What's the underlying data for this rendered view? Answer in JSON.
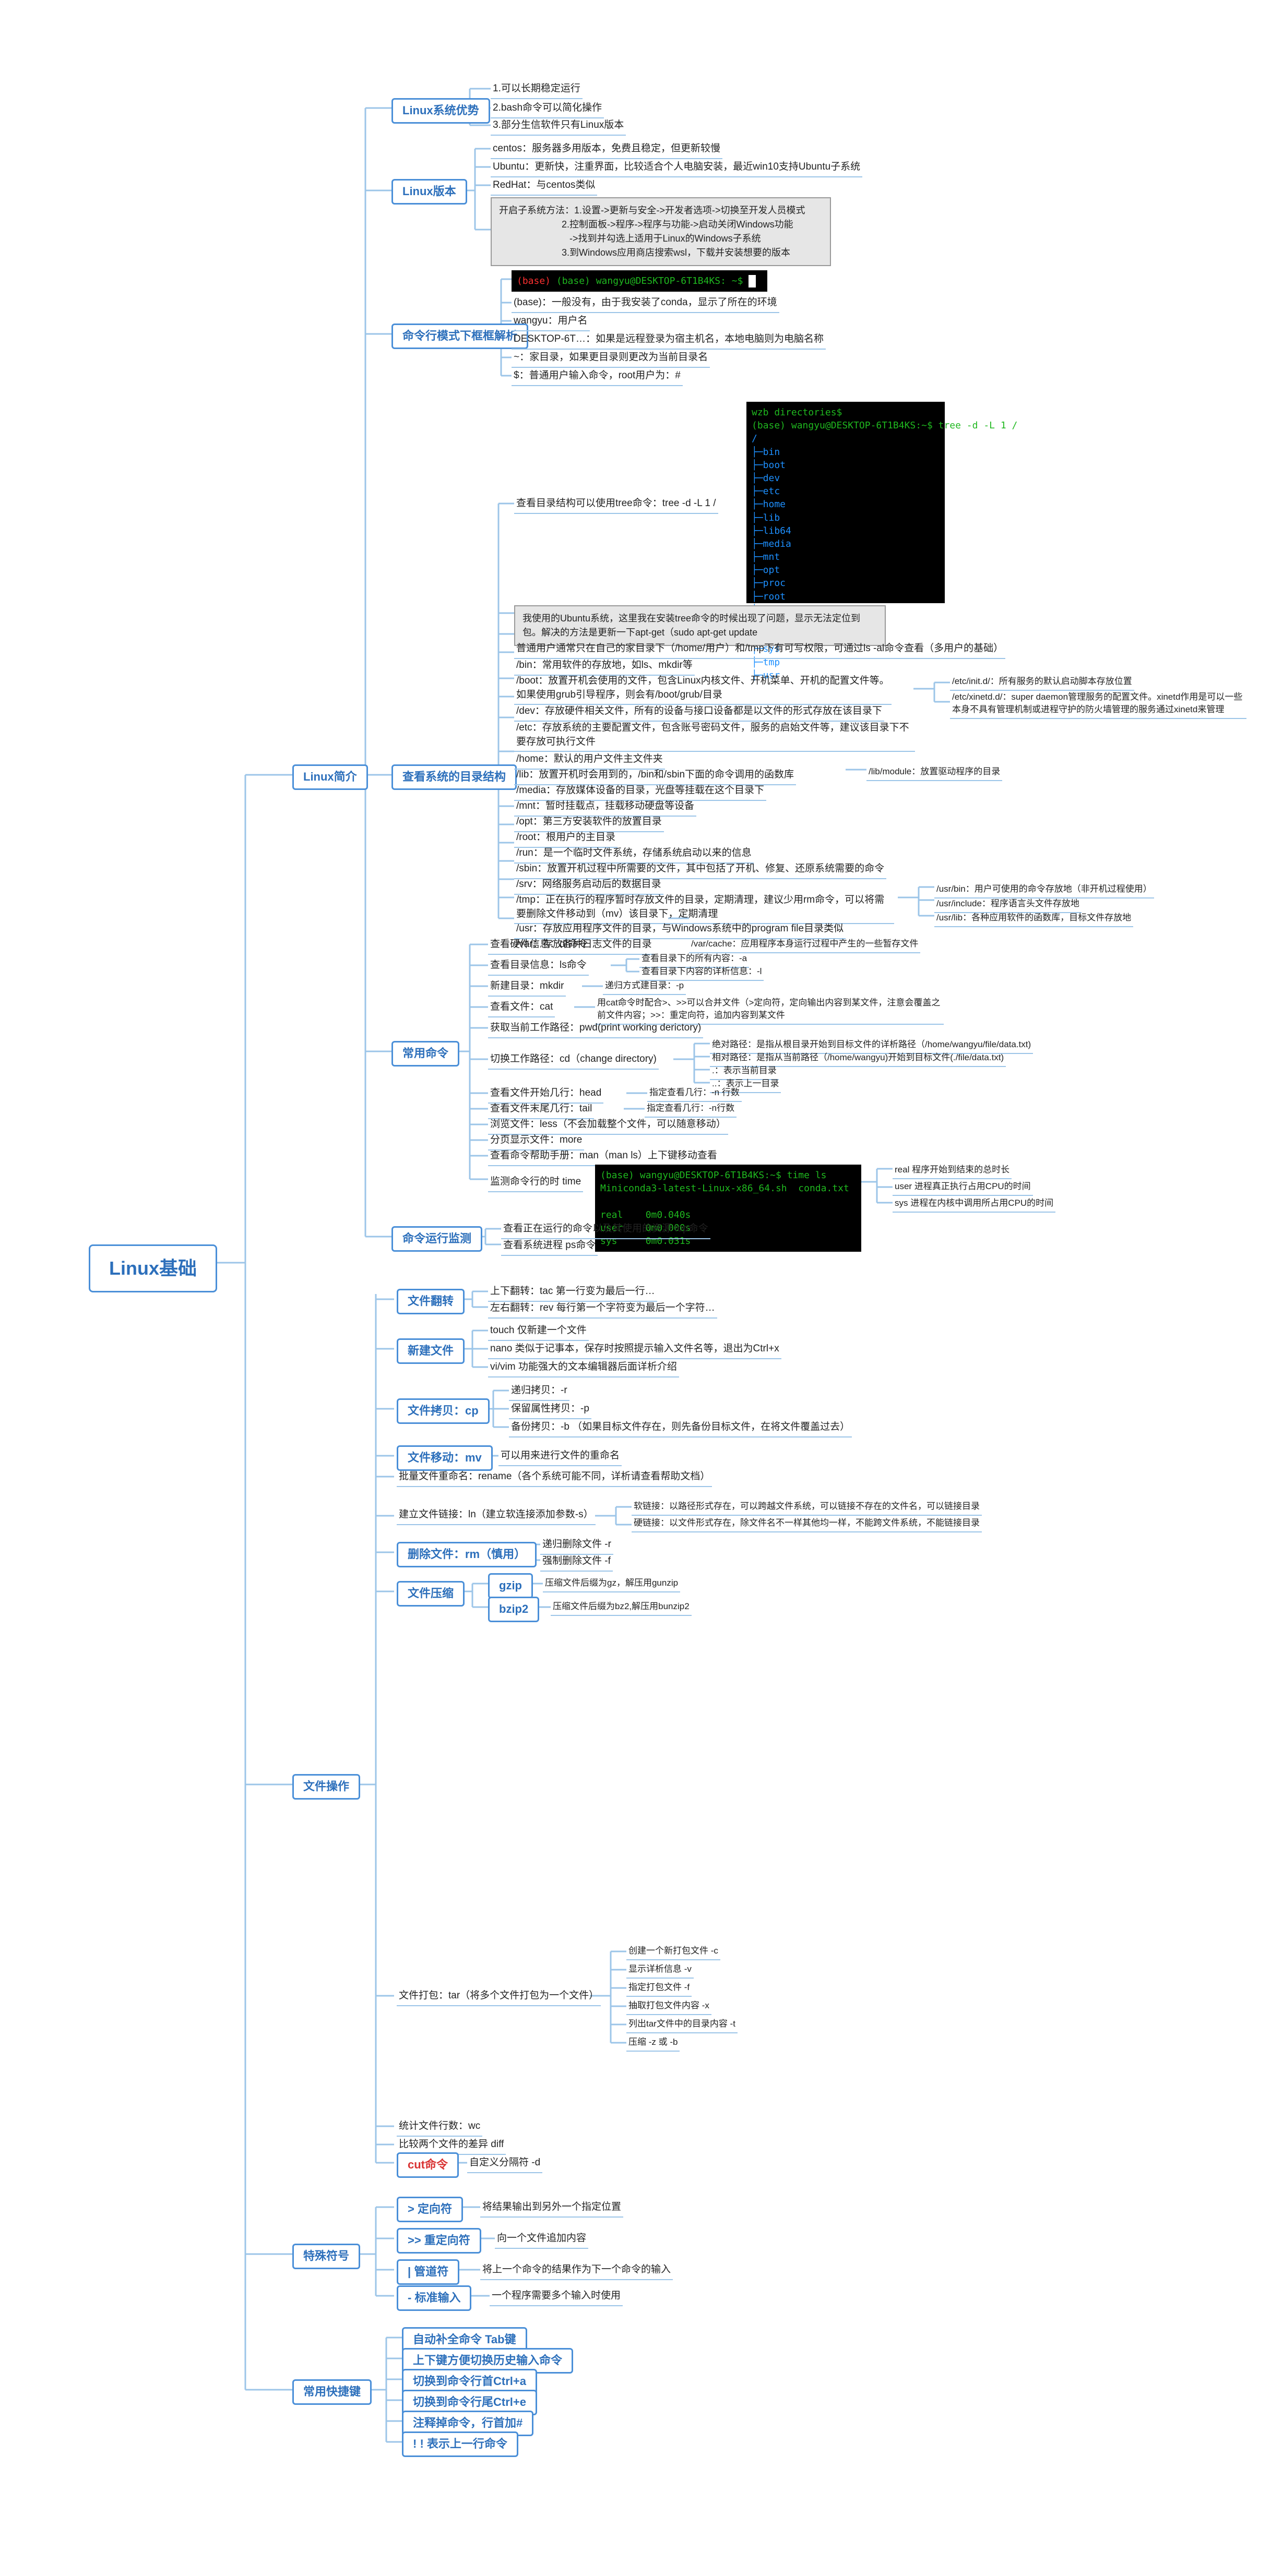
{
  "root": "Linux基础",
  "intro": {
    "title": "Linux简介",
    "advantages": {
      "title": "Linux系统优势",
      "a1": "1.可以长期稳定运行",
      "a2": "2.bash命令可以简化操作",
      "a3": "3.部分生信软件只有Linux版本"
    },
    "versions": {
      "title": "Linux版本",
      "centos": "centos：服务器多用版本，免费且稳定，但更新较慢",
      "ubuntu": "Ubuntu：更新快，注重界面，比较适合个人电脑安装，最近win10支持Ubuntu子系统",
      "redhat": "RedHat：与centos类似",
      "wsl_howto": "开启子系统方法：1.设置->更新与安全->开发者选项->切换至开发人员模式\n                        2.控制面板->程序->程序与功能->启动关闭Windows功能\n                           ->找到并勾选上适用于Linux的Windows子系统\n                        3.到Windows应用商店搜索wsl，下载并安装想要的版本"
    },
    "cmdline": {
      "title": "命令行模式下框框解析",
      "term1": "(base) wangyu@DESKTOP-6T1B4KS: ~$ ",
      "base": "(base)：一般没有，由于我安装了conda，显示了所在的环境",
      "wangyu": "wangyu：用户名",
      "desktop": "DESKTOP-6T…：如果是远程登录为宿主机名，本地电脑则为电脑名称",
      "tilde": "~：家目录，如果更目录则更改为当前目录名",
      "dollar": "$：普通用户输入命令，root用户为：#"
    },
    "dirs": {
      "title": "查看系统的目录结构",
      "tree_note": "查看目录结构可以使用tree命令：tree -d -L 1 /",
      "term2_header": "wzb directories$\n(base) wangyu@DESKTOP-6T1B4KS:~$ tree -d -L 1 /",
      "term2_body": "/\n├─bin\n├─boot\n├─dev\n├─etc\n├─home\n├─lib\n├─lib64\n├─media\n├─mnt\n├─opt\n├─proc\n├─root\n├─run\n├─sbin\n├─srv\n├─sys\n├─tmp\n├─usr",
      "note_apt": "我使用的Ubuntu系统，这里我在安装tree命令的时候出现了问题，显示无法定位到包。解决的方法是更新一下apt-get（sudo apt-get update",
      "normal_user": "普通用户通常只在自己的家目录下（/home/用户）和/tmp下有可写权限，可通过ls -al命令查看（多用户的基础）",
      "bin": "/bin：常用软件的存放地，如ls、mkdir等",
      "boot": "/boot：放置开机会使用的文件，包含Linux内核文件、开机菜单、开机的配置文件等。\n如果使用grub引导程序，则会有/boot/grub/目录",
      "dev": "/dev：存放硬件相关文件，所有的设备与接口设备都是以文件的形式存放在该目录下",
      "etc": "/etc：存放系统的主要配置文件，包含账号密码文件，服务的启始文件等，建议该目录下不要存放可执行文件",
      "etc_init": "/etc/init.d/：所有服务的默认启动脚本存放位置",
      "etc_xinetd": "/etc/xinetd.d/：super daemon管理服务的配置文件。xinetd作用是可以一些本身不具有管理机制或进程守护的防火墙管理的服务通过xinetd来管理",
      "home": "/home：默认的用户文件主文件夹",
      "lib": "/lib：放置开机时会用到的，/bin和/sbin下面的命令调用的函数库",
      "lib_module": "/lib/module：放置驱动程序的目录",
      "media": "/media：存放媒体设备的目录，光盘等挂载在这个目录下",
      "mnt": "/mnt：暂时挂载点，挂载移动硬盘等设备",
      "opt": "/opt：第三方安装软件的放置目录",
      "root_user": "/root：根用户的主目录",
      "run": "/run：是一个临时文件系统，存储系统启动以来的信息",
      "sbin": "/sbin：放置开机过程中所需要的文件，其中包括了开机、修复、还原系统需要的命令",
      "srv": "/srv：网络服务启动后的数据目录",
      "tmp": "/tmp：正在执行的程序暂时存放文件的目录，定期清理，建议少用rm命令，可以将需要删除文件移动到（mv）该目录下，定期清理",
      "usr": "/usr：存放应用程序文件的目录，与Windows系统中的program file目录类似",
      "usr_bin": "/usr/bin：用户可使用的命令存放地（非开机过程使用）",
      "usr_include": "/usr/include：程序语言头文件存放地",
      "usr_lib": "/usr/lib：各种应用软件的函数库，目标文件存放地",
      "var": "/var：存放各种日志文件的目录",
      "var_cache": "/var/cache：应用程序本身运行过程中产生的一些暂存文件"
    },
    "common": {
      "title": "常用命令",
      "df": "查看硬件信息：df命令",
      "ls": "查看目录信息：ls命令",
      "ls_a": "查看目录下的所有内容：-a",
      "ls_l": "查看目录下内容的详析信息：-l",
      "mkdir": "新建目录：mkdir",
      "mkdir_p": "递归方式建目录：-p",
      "cat": "查看文件：cat",
      "cat_note": "用cat命令时配合>、>>可以合并文件（>定向符，定向输出内容到某文件，注意会覆盖之前文件内容；>>：重定向符，追加内容到某文件",
      "pwd": "获取当前工作路径：pwd(print working derictory)",
      "cd": "切换工作路径：cd（change directory)",
      "abs_path": "绝对路径：是指从根目录开始到目标文件的详析路径（/home/wangyu/file/data.txt)",
      "rel_path": "相对路径：是指从当前路径（/home/wangyu)开始到目标文件(./file/data.txt)",
      "dot": ".：表示当前目录",
      "dotdot": "..：表示上一目录",
      "head": "查看文件开始几行：head",
      "head_n": "指定查看几行：-n 行数",
      "tail": "查看文件末尾几行：tail",
      "tail_n": "指定查看几行：-n行数",
      "less": "浏览文件：less（不会加载整个文件，可以随意移动）",
      "more": "分页显示文件：more",
      "man": "查看命令帮助手册：man（man ls）上下键移动查看",
      "time_label": "监测命令行的时 time",
      "term3": "(base) wangyu@DESKTOP-6T1B4KS:~$ time ls\nMiniconda3-latest-Linux-x86_64.sh  conda.txt\n\nreal    0m0.040s\nuser    0m0.000s\nsys     0m0.031s",
      "time_real": "real    程序开始到结束的总时长",
      "time_user": "user  进程真正执行占用CPU的时间",
      "time_sys": "sys  进程在内核中调用所占用CPU的时间"
    },
    "monitor": {
      "title": "命令运行监测",
      "top": "查看正在运行的命令以及其使用的资源  top命令",
      "ps": "查看系统进程 ps命令"
    }
  },
  "fileops": {
    "title": "文件操作",
    "flip": "文件翻转",
    "flip_tac": "上下翻转：tac  第一行变为最后一行…",
    "flip_rev": "左右翻转：rev  每行第一个字符变为最后一个字符…",
    "new": "新建文件",
    "touch": "touch 仅新建一个文件",
    "nano": "nano 类似于记事本，保存时按照提示输入文件名等，退出为Ctrl+x",
    "vi": "vi/vim 功能强大的文本编辑器后面详析介绍",
    "cp": "文件拷贝：cp",
    "cp_r": "递归拷贝：-r",
    "cp_p": "保留属性拷贝：-p",
    "cp_b": "备份拷贝：-b （如果目标文件存在，则先备份目标文件，在将文件覆盖过去）",
    "mv": "文件移动：mv",
    "mv_note": "可以用来进行文件的重命名",
    "rename": "批量文件重命名：rename（各个系统可能不同，详析请查看帮助文档）",
    "ln": "建立文件链接：ln（建立软连接添加参数-s）",
    "ln_soft": "软链接：以路径形式存在，可以跨越文件系统，可以链接不存在的文件名，可以链接目录",
    "ln_hard": "硬链接：以文件形式存在，除文件名不一样其他均一样，不能跨文件系统，不能链接目录",
    "rm": "删除文件：rm（慎用）",
    "rm_r": "递归删除文件  -r",
    "rm_f": "强制删除文件  -f",
    "compress": "文件压缩",
    "gzip": "gzip",
    "gzip_note": "压缩文件后缀为gz，解压用gunzip",
    "bzip2": "bzip2",
    "bzip2_note": "压缩文件后缀为bz2,解压用bunzip2",
    "tar": "文件打包：tar（将多个文件打包为一个文件）",
    "tar_c": "创建一个新打包文件 -c",
    "tar_v": "显示详析信息 -v",
    "tar_f": "指定打包文件 -f",
    "tar_x": "抽取打包文件内容 -x",
    "tar_t": "列出tar文件中的目录内容 -t",
    "tar_z": "压缩 -z 或 -b",
    "wc": "统计文件行数：wc",
    "diff": "比较两个文件的差异 diff",
    "cut": "cut命令",
    "cut_d": "自定义分隔符 -d"
  },
  "special": {
    "title": "特殊符号",
    "redir": "> 定向符",
    "redir_note": "将结果输出到另外一个指定位置",
    "redir2": ">> 重定向符",
    "redir2_note": "向一个文件追加内容",
    "pipe": "| 管道符",
    "pipe_note": "将上一个命令的结果作为下一个命令的输入",
    "stdin": "- 标准输入",
    "stdin_note": "一个程序需要多个输入时使用"
  },
  "shortcut": {
    "title": "常用快捷键",
    "tab": "自动补全命令 Tab键",
    "updown": "上下键方便切换历史输入命令",
    "ctrla": "切换到命令行首Ctrl+a",
    "ctrle": "切换到命令行尾Ctrl+e",
    "hash": "注释掉命令，行首加#",
    "bang": "! !  表示上一行命令"
  }
}
